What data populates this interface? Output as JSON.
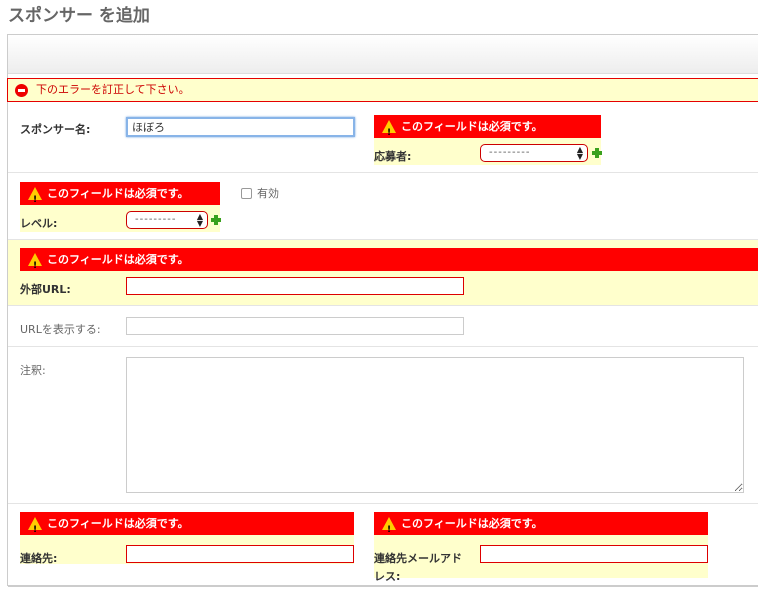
{
  "page_title": "スポンサー を追加",
  "error_note": "下のエラーを訂正して下さい。",
  "required_msg": "このフィールドは必須です。",
  "fields": {
    "sponsor_name": {
      "label": "スポンサー名:",
      "value": "ほぼろ"
    },
    "applicant": {
      "label": "応募者:",
      "selected": "---------"
    },
    "active": {
      "label": "有効"
    },
    "level": {
      "label": "レベル:",
      "selected": "---------"
    },
    "external_url": {
      "label": "外部URL:",
      "value": ""
    },
    "display_url": {
      "label": "URLを表示する:",
      "value": ""
    },
    "notes": {
      "label": "注釈:",
      "value": ""
    },
    "contact": {
      "label": "連絡先:",
      "value": ""
    },
    "contact_email": {
      "label_line1": "連絡先メールアド",
      "label_line2": "レス:",
      "value": ""
    }
  },
  "colors": {
    "error_red": "#ff0000",
    "highlight": "#ffffcc",
    "focus": "#88b4e8",
    "add_icon": "#3aa11d"
  },
  "icons": [
    "error-circle-icon",
    "warning-icon",
    "add-icon",
    "select-arrows-icon"
  ]
}
